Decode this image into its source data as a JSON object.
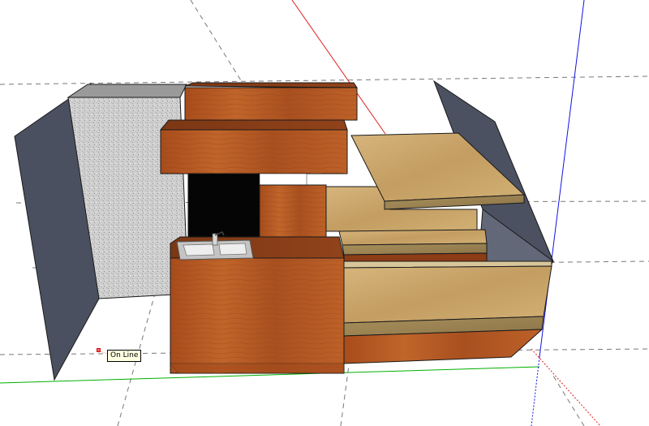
{
  "app": {
    "view": "3d-model-viewport"
  },
  "inference": {
    "tooltip_label": "On Line",
    "cursor_marker": "red-point-marker"
  },
  "axes": {
    "red": "#e02020",
    "green": "#00b000",
    "blue": "#1010e0"
  },
  "colors": {
    "wood": "#b65a22",
    "wood_dark": "#7a3212",
    "osb": "#cba56a",
    "granite": "#c8c8c8",
    "wall": "#4b5160",
    "sink": "#c8c8c8"
  }
}
